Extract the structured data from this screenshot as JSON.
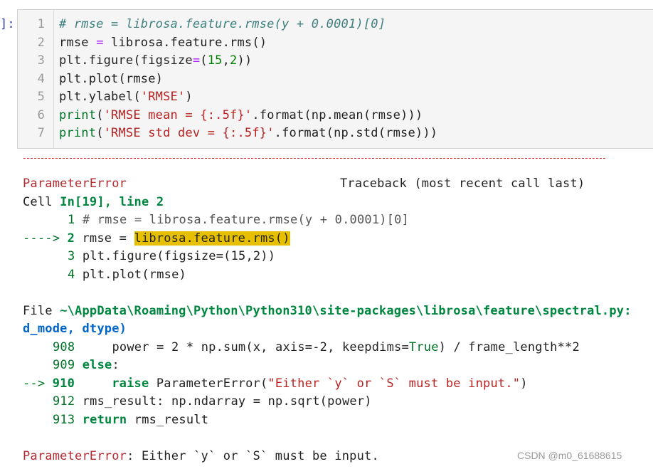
{
  "cell": {
    "prompt": "]:",
    "line_numbers": [
      "1",
      "2",
      "3",
      "4",
      "5",
      "6",
      "7"
    ],
    "lines": [
      {
        "parts": [
          {
            "t": "# rmse = librosa.feature.rmse(y + 0.0001)[0]",
            "c": "cmt"
          }
        ]
      },
      {
        "parts": [
          {
            "t": "rmse ",
            "c": ""
          },
          {
            "t": "=",
            "c": "op"
          },
          {
            "t": " librosa.feature.rms()",
            "c": ""
          }
        ]
      },
      {
        "parts": [
          {
            "t": "plt.figure(figsize",
            "c": ""
          },
          {
            "t": "=",
            "c": "op"
          },
          {
            "t": "(",
            "c": ""
          },
          {
            "t": "15",
            "c": "num"
          },
          {
            "t": ",",
            "c": ""
          },
          {
            "t": "2",
            "c": "num"
          },
          {
            "t": "))",
            "c": ""
          }
        ]
      },
      {
        "parts": [
          {
            "t": "plt.plot(rmse)",
            "c": ""
          }
        ]
      },
      {
        "parts": [
          {
            "t": "plt.ylabel(",
            "c": ""
          },
          {
            "t": "'RMSE'",
            "c": "str"
          },
          {
            "t": ")",
            "c": ""
          }
        ]
      },
      {
        "parts": [
          {
            "t": "print",
            "c": "greenn"
          },
          {
            "t": "(",
            "c": ""
          },
          {
            "t": "'RMSE mean = {:.5f}'",
            "c": "str"
          },
          {
            "t": ".format(np.mean(rmse)))",
            "c": ""
          }
        ]
      },
      {
        "parts": [
          {
            "t": "print",
            "c": "greenn"
          },
          {
            "t": "(",
            "c": ""
          },
          {
            "t": "'RMSE std dev = {:.5f}'",
            "c": "str"
          },
          {
            "t": ".format(np.std(rmse)))",
            "c": ""
          }
        ]
      }
    ]
  },
  "traceback": {
    "error_name": "ParameterError",
    "traceback_header": "Traceback (most recent call last)",
    "cell_ref_prefix": "Cell ",
    "cell_ref": "In[19], line 2",
    "ctx1_num": "1",
    "ctx1_code": " # rmse = librosa.feature.rmse(y + 0.0001)[0]",
    "arrow1": "---->",
    "ctx2_num": "2",
    "ctx2_pre": " rmse = ",
    "ctx2_hl": "librosa.feature.rms()",
    "ctx3_num": "3",
    "ctx3_code": " plt.figure(figsize=(15,2))",
    "ctx4_num": "4",
    "ctx4_code": " plt.plot(rmse)",
    "file_prefix": "File ",
    "file_path": "~\\AppData\\Roaming\\Python\\Python310\\site-packages\\librosa\\feature\\spectral.py:",
    "file_cont": "d_mode, dtype)",
    "l908_num": "908",
    "l908_a": "     power = 2 * np.sum(x, axis=-2, keepdims=",
    "l908_true": "True",
    "l908_b": ") / frame_length**2",
    "l909_num": "909",
    "l909_kw": "else",
    "l909_rest": ":",
    "arrow2": "-->",
    "l910_num": "910",
    "l910_kw": "raise",
    "l910_rest": " ParameterError(",
    "l910_str": "\"Either `y` or `S` must be input.\"",
    "l910_end": ")",
    "l912_num": "912",
    "l912_code": " rms_result: np.ndarray = np.sqrt(power)",
    "l913_num": "913",
    "l913_kw": "return",
    "l913_rest": " rms_result",
    "final_name": "ParameterError",
    "final_msg": ": Either `y` or `S` must be input."
  },
  "watermark": "CSDN @m0_61688615"
}
